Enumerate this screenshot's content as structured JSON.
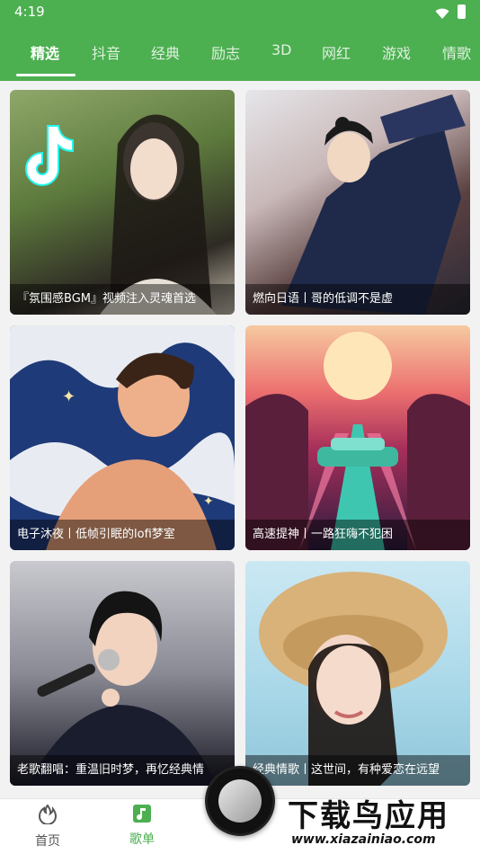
{
  "status": {
    "time": "4:19"
  },
  "tabs": [
    {
      "label": "精选",
      "active": true
    },
    {
      "label": "抖音"
    },
    {
      "label": "经典"
    },
    {
      "label": "励志"
    },
    {
      "label": "3D"
    },
    {
      "label": "网红"
    },
    {
      "label": "游戏"
    },
    {
      "label": "情歌"
    }
  ],
  "cards": [
    {
      "caption": "『氛围感BGM』视频注入灵魂首选"
    },
    {
      "caption": "燃向日语丨哥的低调不是虚"
    },
    {
      "caption": "电子沐夜丨低帧引眠的lofi梦室"
    },
    {
      "caption": "高速提神丨一路狂嗨不犯困"
    },
    {
      "caption": "老歌翻唱：重温旧时梦，再忆经典情"
    },
    {
      "caption": "经典情歌丨这世间，有种爱恋在远望"
    }
  ],
  "bottom_nav": [
    {
      "label": "首页",
      "icon": "flame-icon"
    },
    {
      "label": "歌单",
      "icon": "music-note-icon",
      "active": true
    }
  ],
  "watermark": {
    "title": "下载鸟应用",
    "url": "www.xiazainiao.com"
  },
  "colors": {
    "primary": "#4caf50"
  }
}
